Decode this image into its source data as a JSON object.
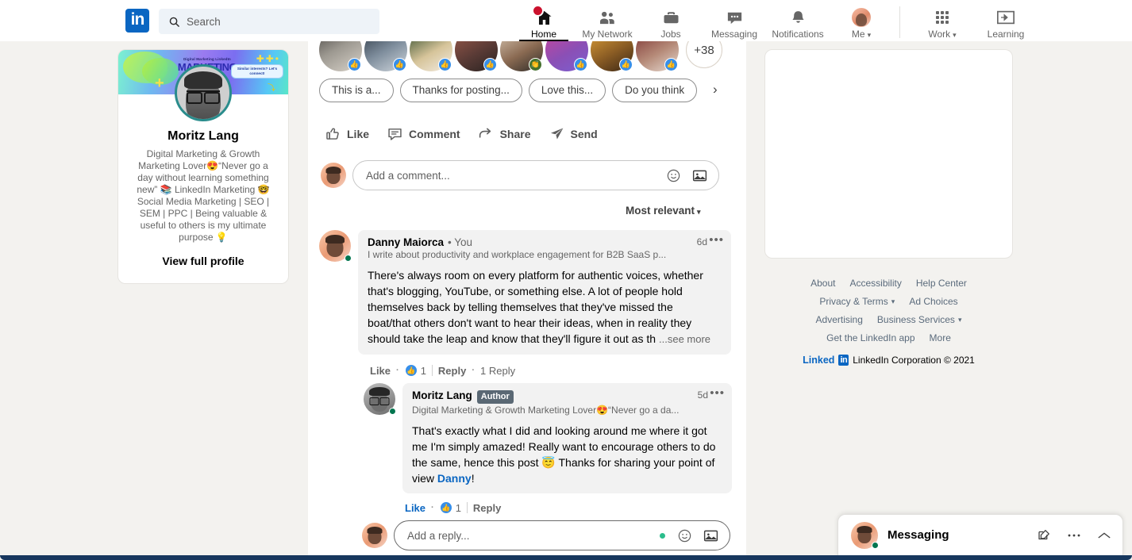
{
  "header": {
    "logo_text": "in",
    "search": {
      "placeholder": "Search",
      "value": "",
      "icon": "search-icon"
    },
    "nav": [
      {
        "label": "Home",
        "icon": "home-icon",
        "active": true,
        "badge": true
      },
      {
        "label": "My Network",
        "icon": "people-icon",
        "active": false,
        "badge": false
      },
      {
        "label": "Jobs",
        "icon": "briefcase-icon",
        "active": false,
        "badge": false
      },
      {
        "label": "Messaging",
        "icon": "chat-bubble-icon",
        "active": false,
        "badge": false
      },
      {
        "label": "Notifications",
        "icon": "bell-icon",
        "active": false,
        "badge": false
      }
    ],
    "me": {
      "label": "Me",
      "caret": "▾",
      "icon": "avatar"
    },
    "work": {
      "label": "Work",
      "caret": "▾",
      "icon": "grid-icon"
    },
    "learning": {
      "label": "Learning",
      "icon": "learning-icon"
    }
  },
  "left_rail": {
    "banner": {
      "line1": "Digital Marketing LinkedIn",
      "line2": "MARKETING",
      "bubble": "Similar interests? Let's connect!"
    },
    "name": "Moritz Lang",
    "description": "Digital Marketing & Growth Marketing Lover😍“Never go a day without learning something new” 📚 LinkedIn Marketing 🤓 Social Media Marketing | SEO | SEM | PPC | Being valuable & useful to others is my ultimate purpose 💡",
    "view_full_profile": "View full profile"
  },
  "post": {
    "reactions_overflow": "+38",
    "reactors": [
      {
        "reaction": "like"
      },
      {
        "reaction": "like"
      },
      {
        "reaction": "like"
      },
      {
        "reaction": "like"
      },
      {
        "reaction": "support"
      },
      {
        "reaction": "like"
      },
      {
        "reaction": "like"
      },
      {
        "reaction": "like"
      }
    ],
    "suggestion_chips": [
      "This is a...",
      "Thanks for posting...",
      "Love this...",
      "Do you think"
    ],
    "chips_next_arrow": "›",
    "actions": [
      {
        "label": "Like",
        "icon": "thumbs-up-icon"
      },
      {
        "label": "Comment",
        "icon": "comment-icon"
      },
      {
        "label": "Share",
        "icon": "share-arrow-icon"
      },
      {
        "label": "Send",
        "icon": "send-paper-plane-icon"
      }
    ],
    "compose": {
      "placeholder": "Add a comment...",
      "value": "",
      "emoji_icon": "emoji-icon",
      "image_icon": "image-icon"
    },
    "sort": {
      "label": "Most relevant",
      "caret": "▾"
    }
  },
  "comments": [
    {
      "name": "Danny Maiorca",
      "you_tag": "• You",
      "author_tag": null,
      "headline": "I write about productivity and workplace engagement for B2B SaaS p...",
      "time": "6d",
      "menu": "•••",
      "text_lines": [
        "There's always room on every platform for authentic voices, whether",
        "that's blogging, YouTube, or something else. A lot of people hold",
        "themselves back by telling themselves that they've missed the",
        "boat/that others don't want to hear their ideas, when in reality they",
        "should take the leap and know that they'll figure it out as th"
      ],
      "see_more": "...see more",
      "like_label": "Like",
      "like_active": false,
      "reaction_count": "1",
      "reply_label": "Reply",
      "reply_count": "1 Reply"
    },
    {
      "name": "Moritz Lang",
      "you_tag": null,
      "author_tag": "Author",
      "headline": "Digital Marketing & Growth Marketing Lover😍“Never go a da...",
      "time": "5d",
      "menu": "•••",
      "text_parts": [
        {
          "t": "That's exactly what I did and looking around me where it got me I'm simply amazed! Really want to encourage others to do the same, hence this post 😇 Thanks for sharing your point of view ",
          "link": false
        },
        {
          "t": "Danny",
          "link": true
        },
        {
          "t": "!",
          "link": false
        }
      ],
      "see_more": null,
      "like_label": "Like",
      "like_active": true,
      "reaction_count": "1",
      "reply_label": "Reply",
      "reply_count": null
    }
  ],
  "reply_compose": {
    "placeholder": "Add a reply...",
    "value": "",
    "emoji_icon": "emoji-icon",
    "image_icon": "image-icon",
    "status_dot": "green"
  },
  "right_rail": {
    "ad_placeholder": "",
    "footer_links_row1": [
      "About",
      "Accessibility",
      "Help Center"
    ],
    "footer_links_row2": [
      "Privacy & Terms",
      "Ad Choices"
    ],
    "footer_links_row3": [
      "Advertising",
      "Business Services"
    ],
    "footer_links_row4": [
      "Get the LinkedIn app",
      "More"
    ],
    "brand_word": "Linked",
    "brand_mark": "in",
    "copyright": "LinkedIn Corporation © 2021"
  },
  "messaging": {
    "title": "Messaging",
    "compose_icon": "compose-pencil-icon",
    "more_icon": "ellipsis-icon",
    "expand_icon": "chevron-up-icon"
  },
  "colors": {
    "brand": "#0a66c2",
    "page_bg": "#f3f2ef",
    "badge_red": "#cb112d",
    "online_green": "#01754f",
    "author_tag_bg": "#5a6874",
    "reaction_blue": "#378fe9"
  }
}
